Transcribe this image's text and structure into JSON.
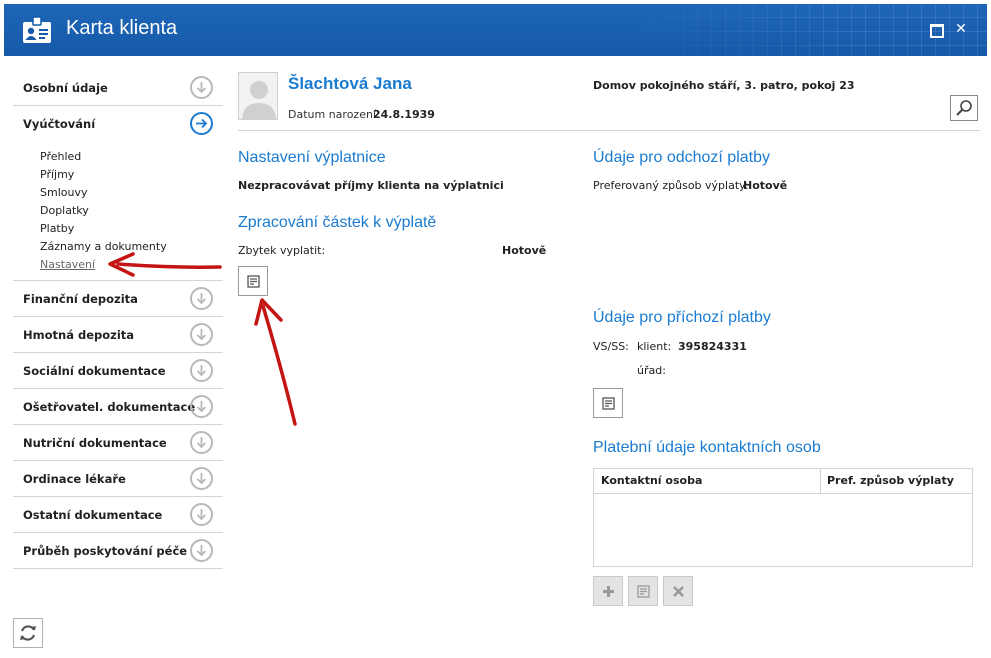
{
  "window": {
    "title": "Karta klienta",
    "accent": "#1a7bd0",
    "titlebar_color": "#155aa8",
    "icons": [
      "client-card-icon",
      "maximize-icon",
      "close-icon"
    ]
  },
  "sidebar": {
    "items": [
      {
        "label": "Osobní údaje",
        "icon": "arrow-down-icon"
      },
      {
        "label": "Vyúčtování",
        "icon": "arrow-right-icon",
        "active": true
      },
      {
        "label": "Finanční depozita",
        "icon": "arrow-down-icon"
      },
      {
        "label": "Hmotná depozita",
        "icon": "arrow-down-icon"
      },
      {
        "label": "Sociální dokumentace",
        "icon": "arrow-down-icon"
      },
      {
        "label": "Ošetřovatel. dokumentace",
        "icon": "arrow-down-icon"
      },
      {
        "label": "Nutriční dokumentace",
        "icon": "arrow-down-icon"
      },
      {
        "label": "Ordinace lékaře",
        "icon": "arrow-down-icon"
      },
      {
        "label": "Ostatní dokumentace",
        "icon": "arrow-down-icon"
      },
      {
        "label": "Průběh poskytování péče",
        "icon": "arrow-down-icon"
      }
    ],
    "submenu": [
      "Přehled",
      "Příjmy",
      "Smlouvy",
      "Doplatky",
      "Platby",
      "Záznamy a dokumenty",
      "Nastavení"
    ],
    "selected_submenu": "Nastavení"
  },
  "client": {
    "name": "Šlachtová Jana",
    "dob_label": "Datum narození:",
    "dob": "24.8.1939",
    "address": "Domov pokojného stáří, 3. patro, pokoj 23"
  },
  "payout_settings": {
    "title": "Nastavení výplatnice",
    "text": "Nezpracovávat příjmy klienta na výplatnici"
  },
  "payout_processing": {
    "title": "Zpracování částek k výplatě",
    "remainder_label": "Zbytek vyplatit:",
    "remainder_value": "Hotově"
  },
  "outgoing": {
    "title": "Údaje pro odchozí platby",
    "pref_label": "Preferovaný způsob výplaty:",
    "pref_value": "Hotově"
  },
  "incoming": {
    "title": "Údaje pro příchozí platby",
    "vs_label": "VS/SS:",
    "client_label": "klient:",
    "client_value": "395824331",
    "office_label": "úřad:"
  },
  "contacts": {
    "title": "Platební údaje kontaktních osob",
    "columns": [
      "Kontaktní osoba",
      "Pref. způsob výplaty"
    ],
    "rows": []
  }
}
